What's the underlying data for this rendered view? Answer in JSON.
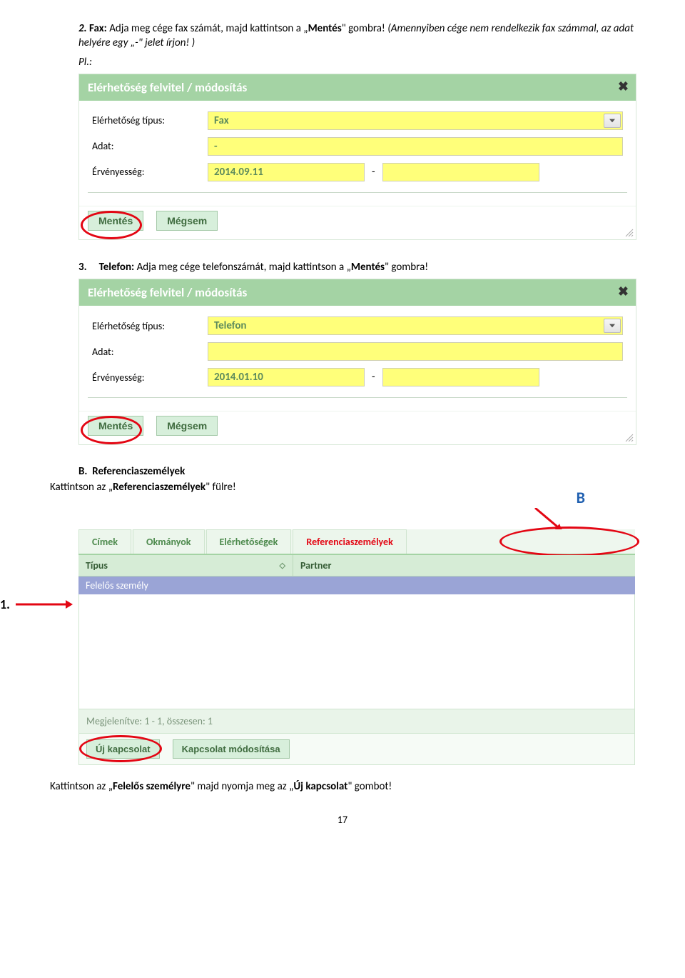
{
  "step2": {
    "num": "2.",
    "label": "Fax:",
    "text_a": " Adja meg cége fax számát, majd kattintson a „",
    "bold": "Mentés",
    "text_b": "\" gombra! ",
    "italic": "(Amennyiben cége nem rendelkezik fax számmal, az adat helyére egy „-\" jelet írjon! )",
    "pl": "Pl.:"
  },
  "dialog1": {
    "title": "Elérhetőség felvitel / módosítás",
    "row1_label": "Elérhetőség típus:",
    "row1_value": "Fax",
    "row2_label": "Adat:",
    "row2_value": "-",
    "row3_label": "Érvényesség:",
    "row3_value": "2014.09.11",
    "row3_sep": "-",
    "btn_save": "Mentés",
    "btn_cancel": "Mégsem"
  },
  "step3": {
    "num": "3.",
    "label": "Telefon:",
    "text_a": " Adja meg cége telefonszámát, majd kattintson a „",
    "bold": "Mentés",
    "text_b": "\" gombra!"
  },
  "dialog2": {
    "title": "Elérhetőség felvitel / módosítás",
    "row1_label": "Elérhetőség típus:",
    "row1_value": "Telefon",
    "row2_label": "Adat:",
    "row2_value": "",
    "row3_label": "Érvényesség:",
    "row3_value": "2014.01.10",
    "row3_sep": "-",
    "btn_save": "Mentés",
    "btn_cancel": "Mégsem"
  },
  "sectionB": {
    "letter": "B.",
    "title": "Referenciaszemélyek",
    "line_a": "Kattintson az „",
    "bold": "Referenciaszemélyek",
    "line_b": "\" fülre!",
    "annot": "B"
  },
  "tabs": {
    "t1": "Címek",
    "t2": "Okmányok",
    "t3": "Elérhetőségek",
    "t4": "Referenciaszemélyek",
    "col1": "Típus",
    "col2": "Partner",
    "row1": "Felelős személy",
    "footer": "Megjelenítve: 1 - 1, összesen: 1",
    "btn_new": "Új kapcsolat",
    "btn_mod": "Kapcsolat módosítása",
    "arrow1_num": "1."
  },
  "footer_line": {
    "a": "Kattintson az „",
    "b1": "Felelős személyre",
    "c": "\" majd nyomja meg az „",
    "b2": "Új kapcsolat",
    "d": "\" gombot!"
  },
  "page_num": "17"
}
